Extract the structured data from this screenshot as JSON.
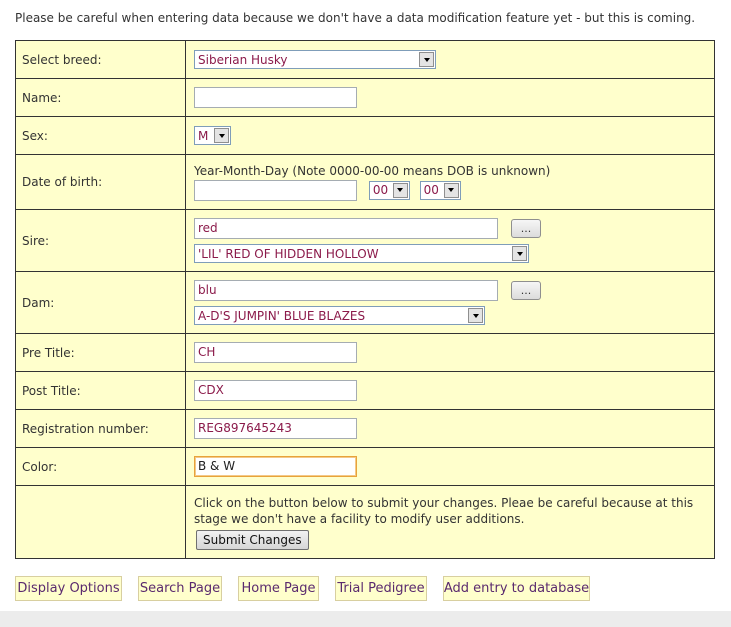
{
  "notice": "Please be careful when entering data because we don't have a data modification feature yet - but this is coming.",
  "form": {
    "breed": {
      "label": "Select breed:",
      "value": "Siberian Husky"
    },
    "name": {
      "label": "Name:",
      "value": ""
    },
    "sex": {
      "label": "Sex:",
      "value": "M"
    },
    "dob": {
      "label": "Date of birth:",
      "hint": "Year-Month-Day (Note 0000-00-00 means DOB is unknown)",
      "year": "",
      "month": "00",
      "day": "00"
    },
    "sire": {
      "label": "Sire:",
      "search": "red",
      "dots": "...",
      "selected": "'LIL' RED OF HIDDEN HOLLOW"
    },
    "dam": {
      "label": "Dam:",
      "search": "blu",
      "dots": "...",
      "selected": "A-D'S JUMPIN' BLUE BLAZES"
    },
    "pre_title": {
      "label": "Pre Title:",
      "value": "CH"
    },
    "post_title": {
      "label": "Post Title:",
      "value": "CDX"
    },
    "registration": {
      "label": "Registration number:",
      "value": "REG897645243"
    },
    "color": {
      "label": "Color:",
      "value": "B & W"
    },
    "submit": {
      "text": "Click on the button below to submit your changes. Pleae be careful because at this stage we don't have a facility to modify user additions.",
      "button": "Submit Changes"
    }
  },
  "nav": [
    {
      "label": "Display Options"
    },
    {
      "label": "Search Page"
    },
    {
      "label": "Home Page"
    },
    {
      "label": "Trial Pedigree"
    },
    {
      "label": "Add entry to database"
    }
  ],
  "colors": {
    "form_background": "#ffffcc",
    "field_text": "#8b1a4a",
    "nav_text": "#5a2a6e"
  }
}
